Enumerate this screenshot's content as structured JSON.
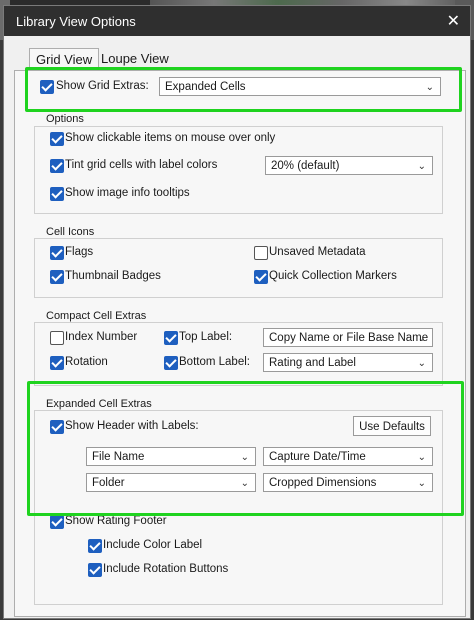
{
  "window": {
    "title": "Library View Options",
    "close_glyph": "✕"
  },
  "tabs": [
    {
      "label": "Grid View"
    },
    {
      "label": "Loupe View"
    }
  ],
  "top": {
    "show_grid_extras_label": "Show Grid Extras:",
    "show_grid_extras_checked": true,
    "mode_value": "Expanded Cells"
  },
  "options": {
    "title": "Options",
    "items": [
      {
        "label": "Show clickable items on mouse over only",
        "checked": true
      },
      {
        "label": "Tint grid cells with label colors",
        "checked": true
      },
      {
        "label": "Show image info tooltips",
        "checked": true
      }
    ],
    "tint_value": "20% (default)"
  },
  "cell_icons": {
    "title": "Cell Icons",
    "items": [
      {
        "label": "Flags",
        "checked": true
      },
      {
        "label": "Unsaved Metadata",
        "checked": false
      },
      {
        "label": "Thumbnail Badges",
        "checked": true
      },
      {
        "label": "Quick Collection Markers",
        "checked": true
      }
    ]
  },
  "compact": {
    "title": "Compact Cell Extras",
    "index_number": {
      "label": "Index Number",
      "checked": false
    },
    "rotation": {
      "label": "Rotation",
      "checked": true
    },
    "top_label": {
      "label": "Top Label:",
      "checked": true,
      "value": "Copy Name or File Base Name"
    },
    "bottom_label": {
      "label": "Bottom Label:",
      "checked": true,
      "value": "Rating and Label"
    }
  },
  "expanded": {
    "title": "Expanded Cell Extras",
    "show_header": {
      "label": "Show Header with Labels:",
      "checked": true
    },
    "use_defaults_label": "Use Defaults",
    "fields": [
      "File Name",
      "Capture Date/Time",
      "Folder",
      "Cropped Dimensions"
    ],
    "rating_footer": {
      "label": "Show Rating Footer",
      "checked": true
    },
    "include_color_label": {
      "label": "Include Color Label",
      "checked": true
    },
    "include_rotation_buttons": {
      "label": "Include Rotation Buttons",
      "checked": true
    }
  },
  "colors": {
    "accent": "#1e5fbf",
    "highlight": "#1fd31f",
    "title_bar": "#2f2f2f"
  }
}
